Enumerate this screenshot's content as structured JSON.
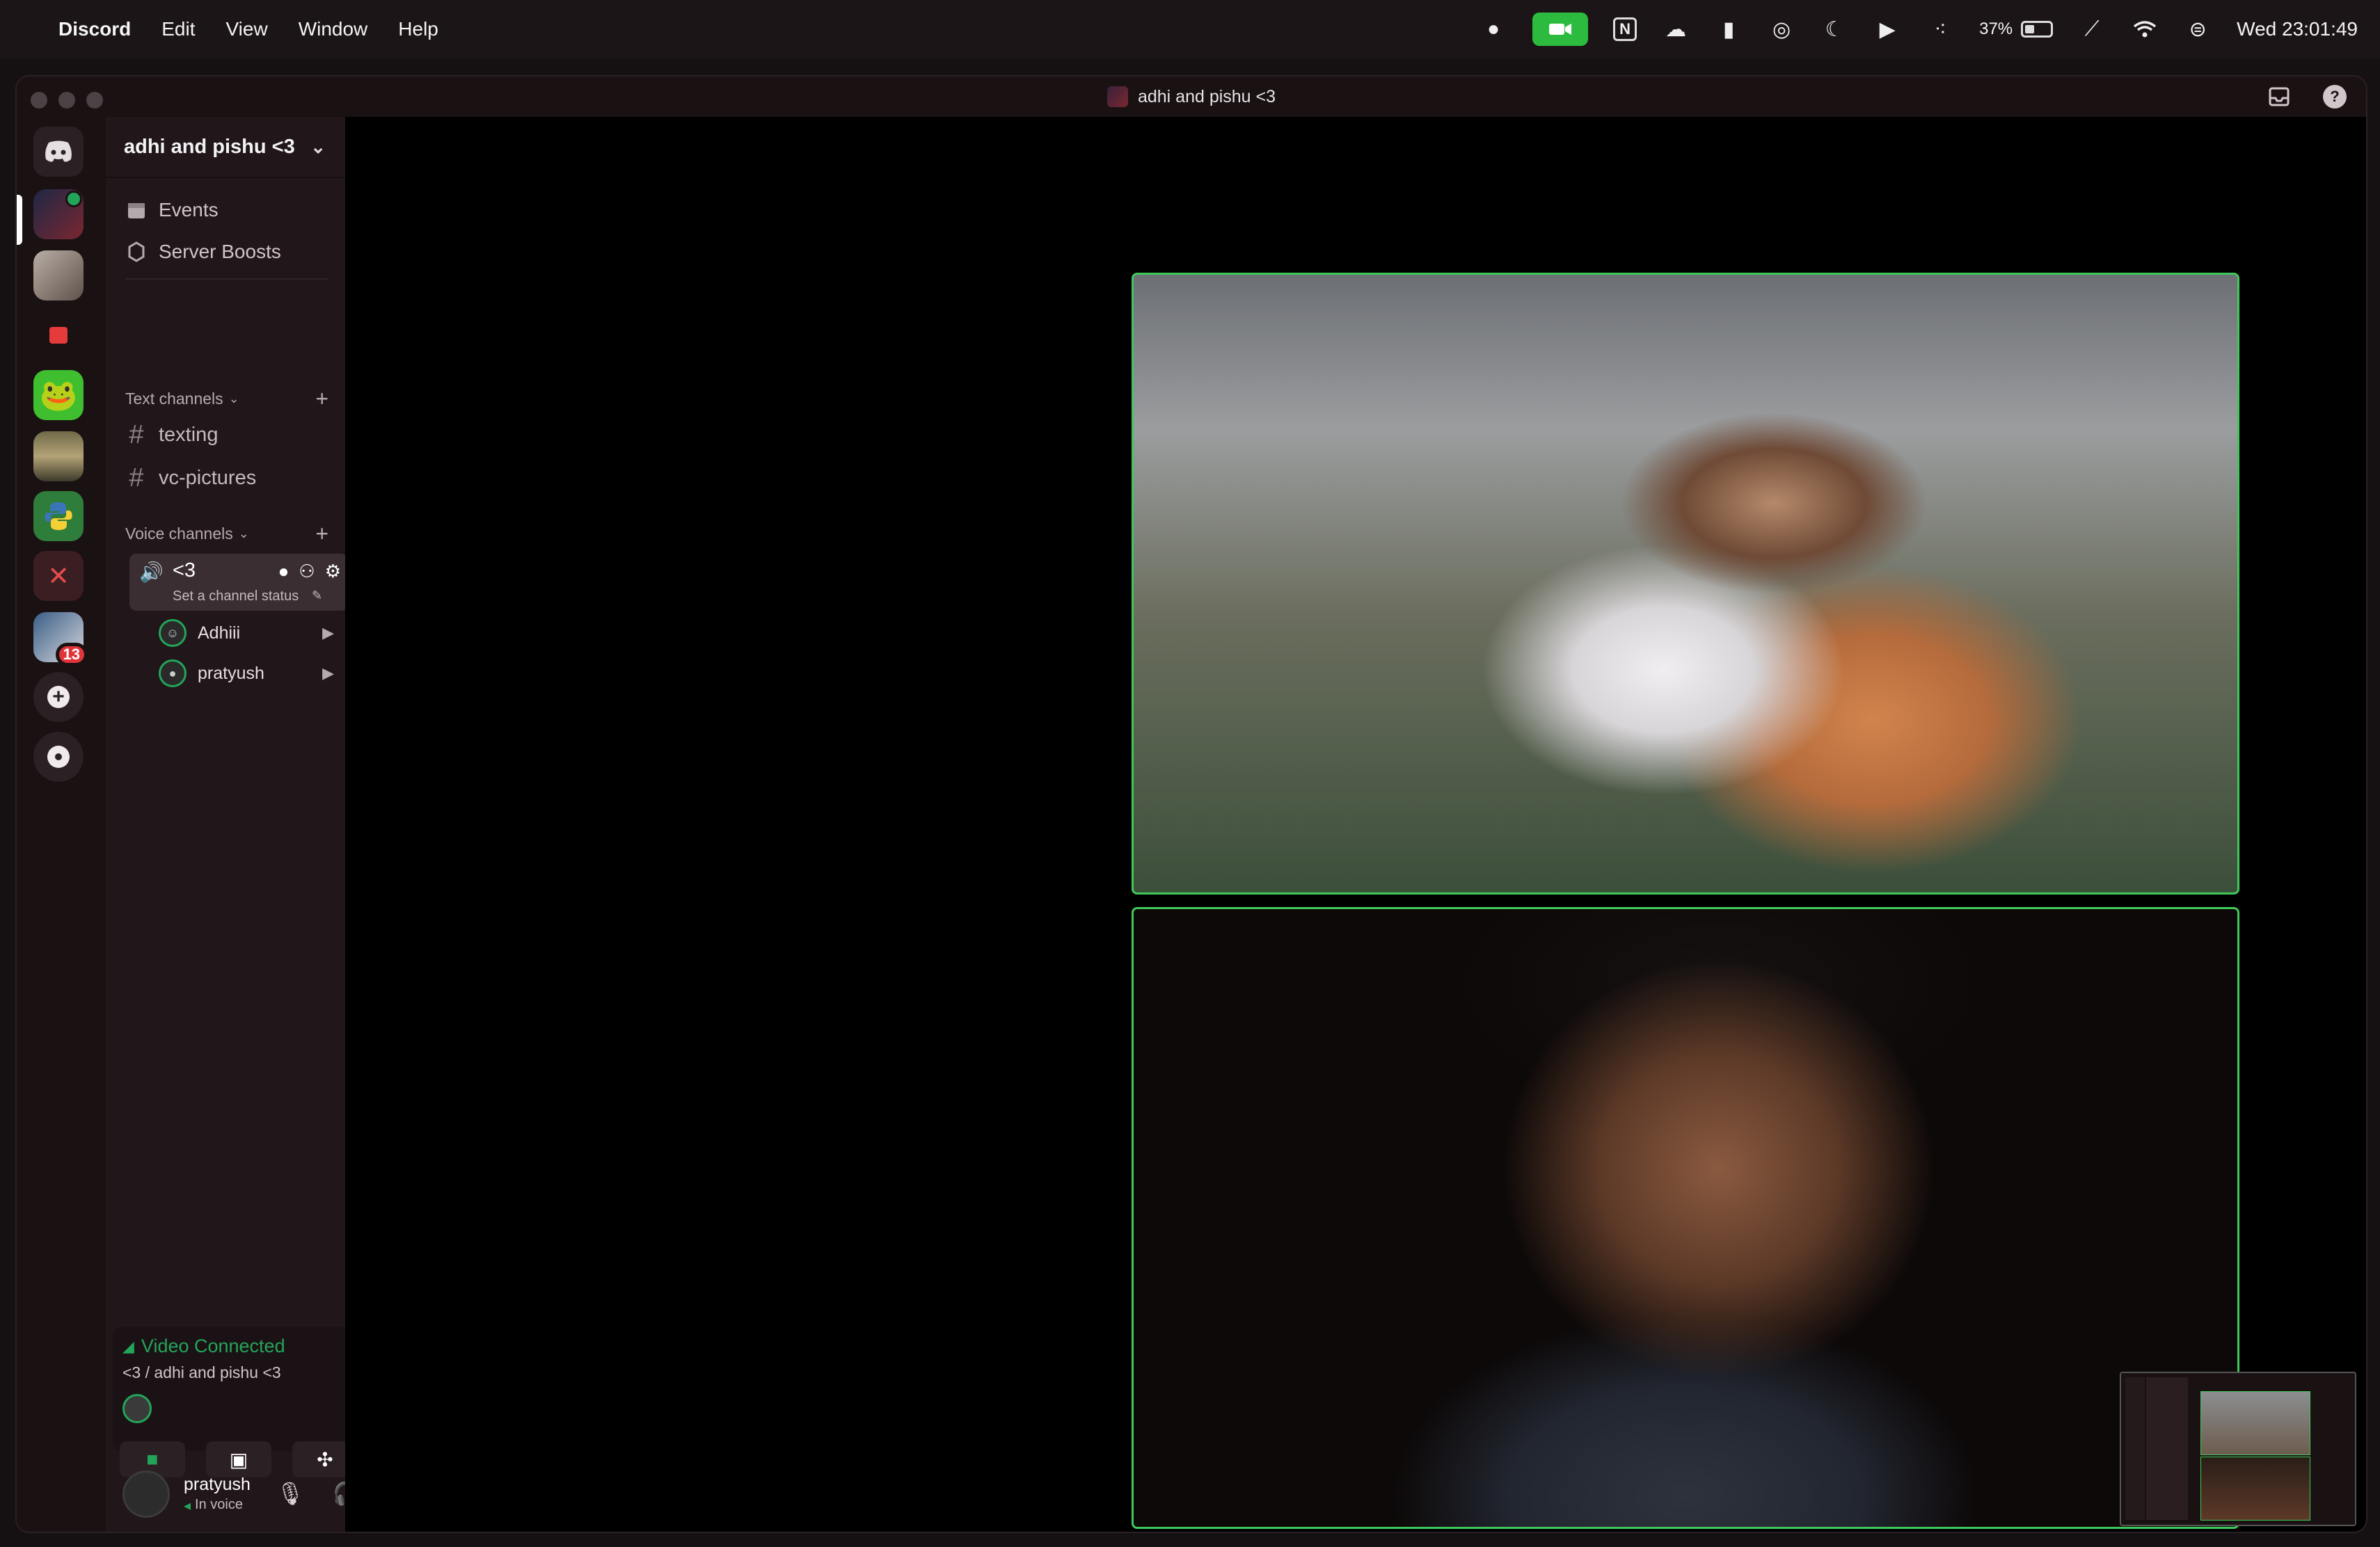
{
  "menubar": {
    "app_name": "Discord",
    "menus": [
      "Edit",
      "View",
      "Window",
      "Help"
    ],
    "battery_percent": "37%",
    "battery_level": 0.37,
    "clock": "Wed 23:01:49"
  },
  "window": {
    "title": "adhi and pishu <3"
  },
  "server": {
    "name": "adhi and pishu <3",
    "items": [
      {
        "label": "Events",
        "icon": "calendar-icon"
      },
      {
        "label": "Server Boosts",
        "icon": "boost-icon"
      }
    ],
    "text_category": "Text channels",
    "text_channels": [
      "texting",
      "vc-pictures"
    ],
    "voice_category": "Voice channels",
    "voice_channel": {
      "name": "<3",
      "status_placeholder": "Set a channel status",
      "members": [
        {
          "name": "Adhiii",
          "camera": true
        },
        {
          "name": "pratyush",
          "camera": true
        }
      ]
    }
  },
  "guilds": {
    "notification_badge": "13"
  },
  "voice_panel": {
    "status": "Video Connected",
    "location": "<3 / adhi and pishu <3"
  },
  "user": {
    "name": "pratyush",
    "status": "In voice"
  },
  "colors": {
    "accent_green": "#23a559",
    "tile_border": "#3fc85a",
    "badge_red": "#e0343a"
  }
}
